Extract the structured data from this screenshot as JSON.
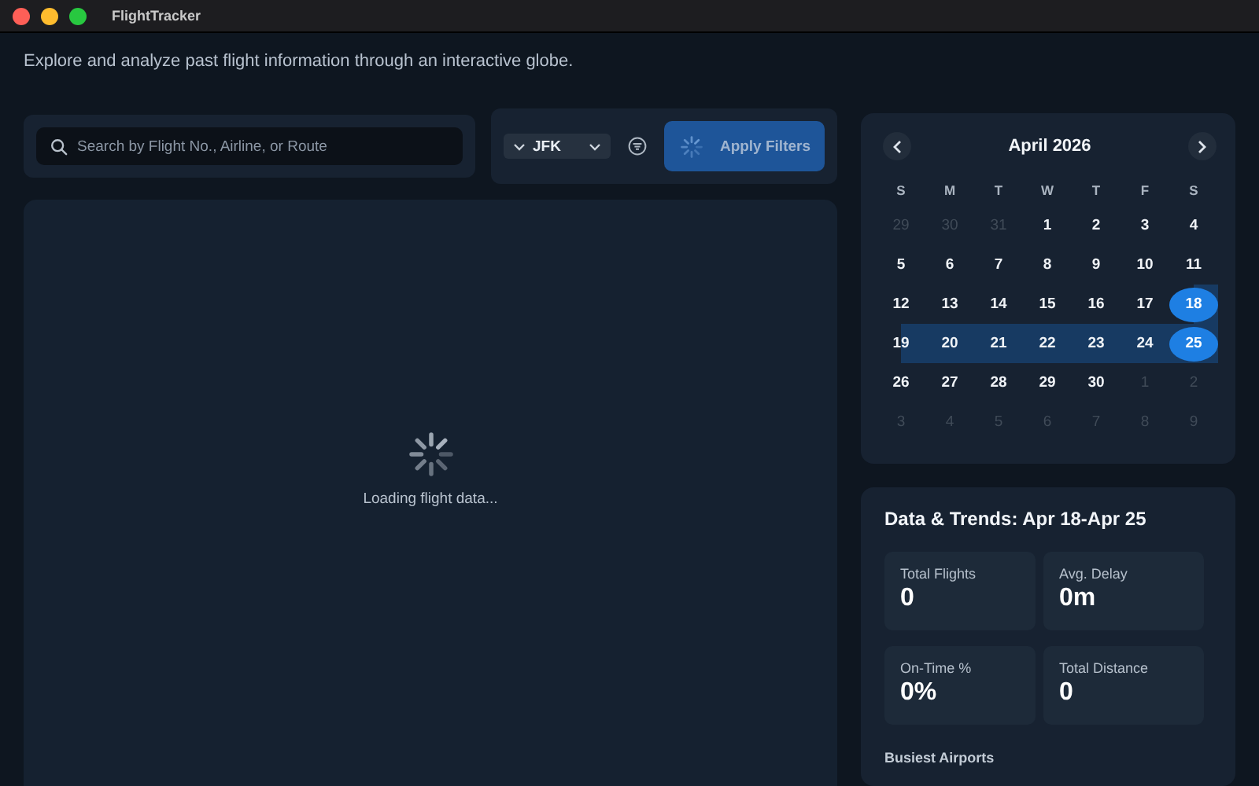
{
  "window": {
    "title": "FlightTracker"
  },
  "page": {
    "subtitle": "Explore and analyze past flight information through an interactive globe."
  },
  "search": {
    "placeholder": "Search by Flight No., Airline, or Route"
  },
  "filters": {
    "airport": "JFK",
    "apply_label": "Apply Filters",
    "loading": true
  },
  "map": {
    "loading_text": "Loading flight data..."
  },
  "calendar": {
    "month": "April 2026",
    "weekdays": [
      "S",
      "M",
      "T",
      "W",
      "T",
      "F",
      "S"
    ],
    "days": [
      {
        "label": "29",
        "outside": true,
        "selected": false,
        "in_range": false
      },
      {
        "label": "30",
        "outside": true,
        "selected": false,
        "in_range": false
      },
      {
        "label": "31",
        "outside": true,
        "selected": false,
        "in_range": false
      },
      {
        "label": "1",
        "outside": false,
        "selected": false,
        "in_range": false
      },
      {
        "label": "2",
        "outside": false,
        "selected": false,
        "in_range": false
      },
      {
        "label": "3",
        "outside": false,
        "selected": false,
        "in_range": false
      },
      {
        "label": "4",
        "outside": false,
        "selected": false,
        "in_range": false
      },
      {
        "label": "5",
        "outside": false,
        "selected": false,
        "in_range": false
      },
      {
        "label": "6",
        "outside": false,
        "selected": false,
        "in_range": false
      },
      {
        "label": "7",
        "outside": false,
        "selected": false,
        "in_range": false
      },
      {
        "label": "8",
        "outside": false,
        "selected": false,
        "in_range": false
      },
      {
        "label": "9",
        "outside": false,
        "selected": false,
        "in_range": false
      },
      {
        "label": "10",
        "outside": false,
        "selected": false,
        "in_range": false
      },
      {
        "label": "11",
        "outside": false,
        "selected": false,
        "in_range": false
      },
      {
        "label": "12",
        "outside": false,
        "selected": false,
        "in_range": false
      },
      {
        "label": "13",
        "outside": false,
        "selected": false,
        "in_range": false
      },
      {
        "label": "14",
        "outside": false,
        "selected": false,
        "in_range": false
      },
      {
        "label": "15",
        "outside": false,
        "selected": false,
        "in_range": false
      },
      {
        "label": "16",
        "outside": false,
        "selected": false,
        "in_range": false
      },
      {
        "label": "17",
        "outside": false,
        "selected": false,
        "in_range": false
      },
      {
        "label": "18",
        "outside": false,
        "selected": true,
        "in_range": true
      },
      {
        "label": "19",
        "outside": false,
        "selected": false,
        "in_range": true
      },
      {
        "label": "20",
        "outside": false,
        "selected": false,
        "in_range": true
      },
      {
        "label": "21",
        "outside": false,
        "selected": false,
        "in_range": true
      },
      {
        "label": "22",
        "outside": false,
        "selected": false,
        "in_range": true
      },
      {
        "label": "23",
        "outside": false,
        "selected": false,
        "in_range": true
      },
      {
        "label": "24",
        "outside": false,
        "selected": false,
        "in_range": true
      },
      {
        "label": "25",
        "outside": false,
        "selected": true,
        "in_range": true
      },
      {
        "label": "26",
        "outside": false,
        "selected": false,
        "in_range": false
      },
      {
        "label": "27",
        "outside": false,
        "selected": false,
        "in_range": false
      },
      {
        "label": "28",
        "outside": false,
        "selected": false,
        "in_range": false
      },
      {
        "label": "29",
        "outside": false,
        "selected": false,
        "in_range": false
      },
      {
        "label": "30",
        "outside": false,
        "selected": false,
        "in_range": false
      },
      {
        "label": "1",
        "outside": true,
        "selected": false,
        "in_range": false
      },
      {
        "label": "2",
        "outside": true,
        "selected": false,
        "in_range": false
      },
      {
        "label": "3",
        "outside": true,
        "selected": false,
        "in_range": false
      },
      {
        "label": "4",
        "outside": true,
        "selected": false,
        "in_range": false
      },
      {
        "label": "5",
        "outside": true,
        "selected": false,
        "in_range": false
      },
      {
        "label": "6",
        "outside": true,
        "selected": false,
        "in_range": false
      },
      {
        "label": "7",
        "outside": true,
        "selected": false,
        "in_range": false
      },
      {
        "label": "8",
        "outside": true,
        "selected": false,
        "in_range": false
      },
      {
        "label": "9",
        "outside": true,
        "selected": false,
        "in_range": false
      }
    ]
  },
  "trends": {
    "title": "Data & Trends: Apr 18-Apr 25",
    "stats": [
      {
        "label": "Total Flights",
        "value": "0"
      },
      {
        "label": "Avg. Delay",
        "value": "0m"
      },
      {
        "label": "On-Time %",
        "value": "0%"
      },
      {
        "label": "Total Distance",
        "value": "0"
      }
    ],
    "section_title": "Busiest Airports"
  }
}
